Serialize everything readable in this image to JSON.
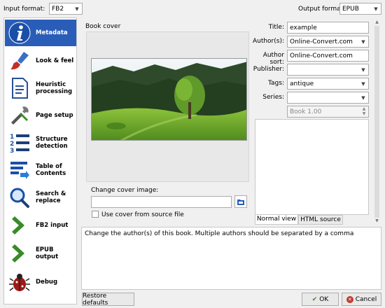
{
  "top": {
    "input_format_label": "Input format:",
    "input_format_value": "FB2",
    "output_format_label": "Output format:",
    "output_format_value": "EPUB"
  },
  "sidebar": {
    "items": [
      {
        "label": "Metadata",
        "icon": "info-icon",
        "active": true
      },
      {
        "label": "Look & feel",
        "icon": "brush-icon"
      },
      {
        "label": "Heuristic processing",
        "icon": "document-icon"
      },
      {
        "label": "Page setup",
        "icon": "tools-icon"
      },
      {
        "label": "Structure detection",
        "icon": "numbered-list-icon"
      },
      {
        "label": "Table of Contents",
        "icon": "toc-icon"
      },
      {
        "label": "Search & replace",
        "icon": "magnifier-icon"
      },
      {
        "label": "FB2 input",
        "icon": "arrow-right-icon"
      },
      {
        "label": "EPUB output",
        "icon": "arrow-right-icon"
      },
      {
        "label": "Debug",
        "icon": "bug-icon"
      }
    ]
  },
  "cover": {
    "group_title": "Book cover",
    "change_label": "Change cover image:",
    "path_value": "",
    "use_source_label": "Use cover from source file",
    "use_source_checked": false
  },
  "meta": {
    "title_label": "Title:",
    "title_value": "example",
    "authors_label": "Author(s):",
    "authors_value": "Online-Convert.com",
    "author_sort_label": "Author sort:",
    "author_sort_value": "Online-Convert.com",
    "publisher_label": "Publisher:",
    "publisher_value": "",
    "tags_label": "Tags:",
    "tags_value": "antique",
    "series_label": "Series:",
    "series_value": "",
    "series_index": "Book 1.00"
  },
  "comments": {
    "tab_normal": "Normal view",
    "tab_html": "HTML source"
  },
  "help_text": "Change the author(s) of this book. Multiple authors should be separated by a comma",
  "buttons": {
    "restore": "Restore defaults",
    "ok": "OK",
    "cancel": "Cancel"
  },
  "colors": {
    "accent": "#2a5db8",
    "ok_check": "#3a8a2a",
    "cancel_x": "#c0392b"
  }
}
